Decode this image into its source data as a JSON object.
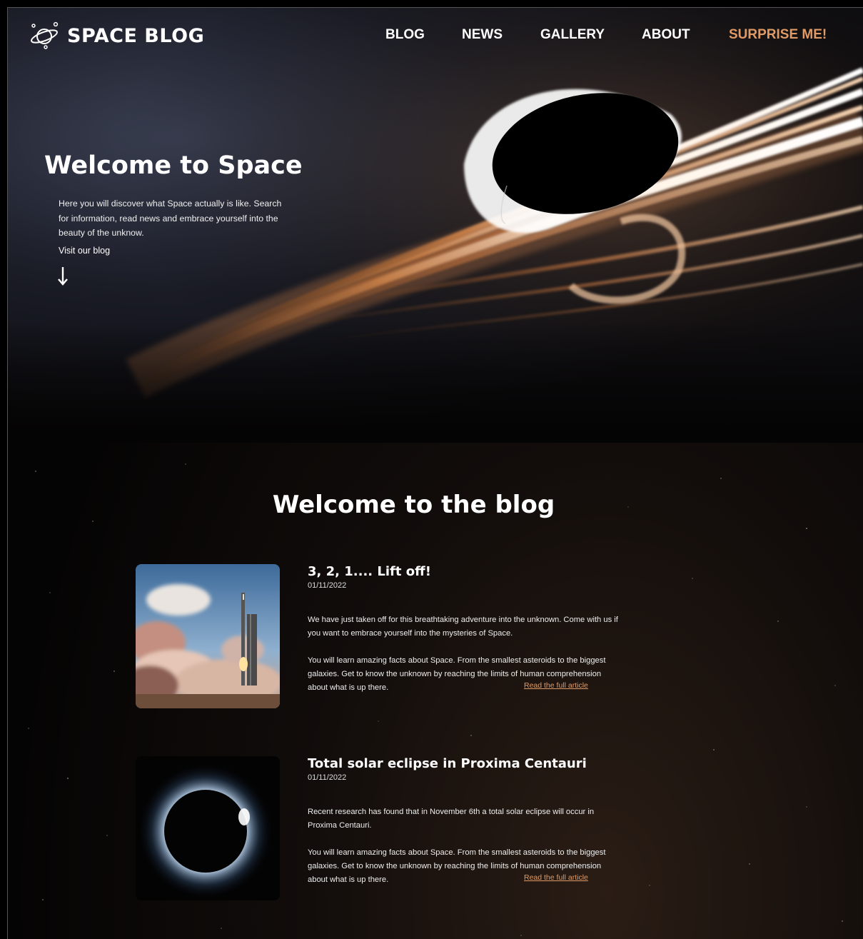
{
  "nav": {
    "brand": "SPACE BLOG",
    "links": [
      "BLOG",
      "NEWS",
      "GALLERY",
      "ABOUT"
    ],
    "cta": "SURPRISE ME!"
  },
  "hero": {
    "title": "Welcome to Space",
    "text": "Here you will discover what Space actually is like. Search for information, read news and embrace yourself into the beauty of  the unknow.",
    "link": "Visit our blog"
  },
  "blog": {
    "title": "Welcome to the blog",
    "posts": [
      {
        "title": "3, 2, 1.... Lift off!",
        "date": "01/11/2022",
        "p1": "We have just taken off for this breathtaking adventure into the unknown. Come with us if you want to embrace yourself into the mysteries of Space.",
        "p2": "You will learn amazing facts about Space. From the smallest asteroids to the biggest galaxies. Get to know the unknown by reaching the limits of human comprehension about what is up there.",
        "link": "Read the full article"
      },
      {
        "title": "Total solar eclipse in Proxima Centauri",
        "date": "01/11/2022",
        "p1": "Recent research has found that in November 6th a total solar eclipse will occur in Proxima Centauri.",
        "p2": "You will learn amazing facts about Space. From the smallest asteroids to the biggest galaxies. Get to know the unknown by reaching the limits of human comprehension about what is up there.",
        "link": "Read the full article"
      }
    ]
  },
  "colors": {
    "accent": "#e09a66",
    "background": "#050404"
  },
  "icons": {
    "logo": "planet-icon",
    "hero_arrow": "arrow-down-icon"
  }
}
